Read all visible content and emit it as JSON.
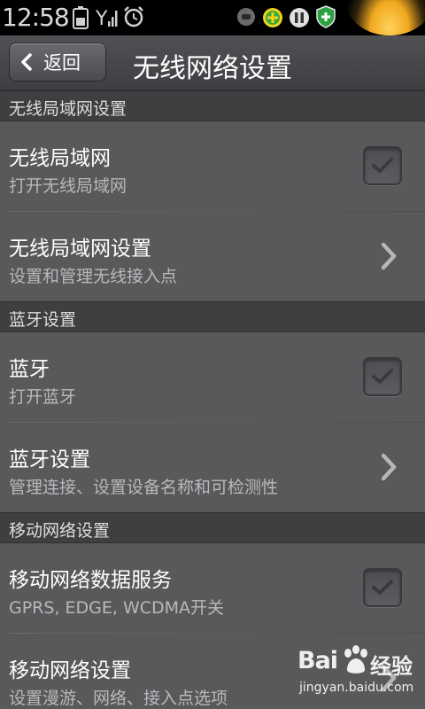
{
  "status_bar": {
    "time": "12:58",
    "icons": [
      "battery-icon",
      "signal-icon",
      "alarm-clock-icon",
      "usb-debug-icon",
      "android-helper-icon",
      "pause-icon",
      "security-shield-icon"
    ]
  },
  "title_bar": {
    "back_label": "返回",
    "title": "无线网络设置"
  },
  "sections": [
    {
      "header": "无线局域网设置",
      "items": [
        {
          "title": "无线局域网",
          "subtitle": "打开无线局域网",
          "control": "checkbox"
        },
        {
          "title": "无线局域网设置",
          "subtitle": "设置和管理无线接入点",
          "control": "chevron"
        }
      ]
    },
    {
      "header": "蓝牙设置",
      "items": [
        {
          "title": "蓝牙",
          "subtitle": "打开蓝牙",
          "control": "checkbox"
        },
        {
          "title": "蓝牙设置",
          "subtitle": "管理连接、设置设备名称和可检测性",
          "control": "chevron"
        }
      ]
    },
    {
      "header": "移动网络设置",
      "items": [
        {
          "title": "移动网络数据服务",
          "subtitle": "GPRS, EDGE, WCDMA开关",
          "control": "checkbox"
        },
        {
          "title": "移动网络设置",
          "subtitle": "设置漫游、网络、接入点选项",
          "control": "chevron"
        }
      ]
    }
  ],
  "watermark": {
    "logo_left": "Bai",
    "logo_right": "经验",
    "url": "jingyan.baidu.com"
  },
  "colors": {
    "background": "#58595b",
    "section_header": "#3e3f41",
    "subtitle_text": "#b8b9bb"
  }
}
